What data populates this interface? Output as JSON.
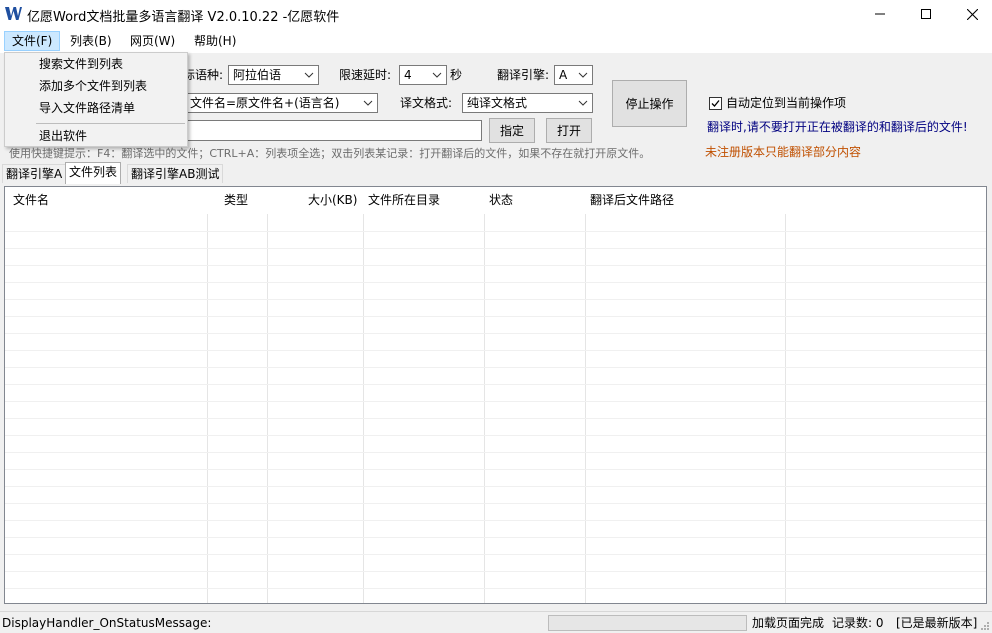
{
  "window": {
    "title": "亿愿Word文档批量多语言翻译 V2.0.10.22 -亿愿软件",
    "logo_icon": "app-logo-w-icon",
    "controls": [
      "minimize-icon",
      "maximize-icon",
      "close-icon"
    ]
  },
  "menubar": {
    "items": [
      {
        "label": "文件(F)",
        "active": true
      },
      {
        "label": "列表(B)"
      },
      {
        "label": "网页(W)"
      },
      {
        "label": "帮助(H)"
      }
    ]
  },
  "file_menu": {
    "items": [
      "搜索文件到列表",
      "添加多个文件到列表",
      "导入文件路径清单",
      "退出软件"
    ]
  },
  "toolbar": {
    "target_lang_label": "标语种:",
    "target_lang_value": "阿拉伯语",
    "delay_label": "限速延时:",
    "delay_value": "4",
    "delay_unit": "秒",
    "engine_label": "翻译引擎:",
    "engine_value": "A",
    "naming_value": "文件名=原文件名+(语言名)",
    "format_label": "译文格式:",
    "format_value": "纯译文格式",
    "stop_button": "停止操作",
    "specify_button": "指定",
    "open_button": "打开",
    "auto_locate_label": "自动定位到当前操作项",
    "auto_locate_checked": true,
    "warning_text": "翻译时,请不要打开正在被翻译的和翻译后的文件!",
    "unregistered_text": "未注册版本只能翻译部分内容",
    "hint_text": "使用快捷键提示：F4：翻译选中的文件；CTRL+A：列表项全选；双击列表某记录：打开翻译后的文件，如果不存在就打开原文件。",
    "colors": {
      "warning": "#000080",
      "unregistered": "#c05000"
    }
  },
  "tabs": [
    {
      "label": "翻译引擎A"
    },
    {
      "label": "文件列表",
      "active": true
    },
    {
      "label": "翻译引擎AB测试"
    }
  ],
  "table": {
    "columns": [
      "文件名",
      "类型",
      "大小(KB)",
      "文件所在目录",
      "状态",
      "翻译后文件路径"
    ],
    "rows": []
  },
  "statusbar": {
    "message": "DisplayHandler_OnStatusMessage:",
    "load_status": "加载页面完成",
    "record_count": "记录数: 0",
    "version_status": "[已是最新版本]",
    "progress": 0
  }
}
